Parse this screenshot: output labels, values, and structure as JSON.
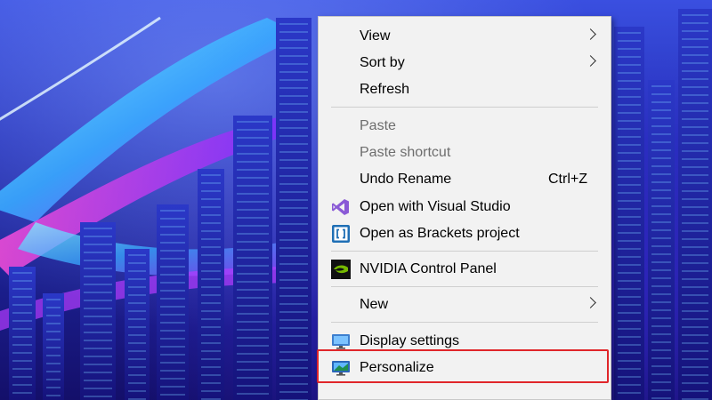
{
  "desktop": {
    "wallpaper": "neon city skyline with glowing curved light streaks"
  },
  "context_menu": {
    "items": [
      {
        "label": "View",
        "has_submenu": true
      },
      {
        "label": "Sort by",
        "has_submenu": true
      },
      {
        "label": "Refresh"
      },
      {
        "label": "Paste",
        "disabled": true
      },
      {
        "label": "Paste shortcut",
        "disabled": true
      },
      {
        "label": "Undo Rename",
        "shortcut": "Ctrl+Z"
      },
      {
        "label": "Open with Visual Studio",
        "icon": "visual-studio-icon"
      },
      {
        "label": "Open as Brackets project",
        "icon": "brackets-icon"
      },
      {
        "label": "NVIDIA Control Panel",
        "icon": "nvidia-icon"
      },
      {
        "label": "New",
        "has_submenu": true
      },
      {
        "label": "Display settings",
        "icon": "display-settings-icon"
      },
      {
        "label": "Personalize",
        "icon": "personalize-icon",
        "highlighted": true
      }
    ]
  },
  "colors": {
    "menu_background": "#f2f2f2",
    "disabled_text": "#6d6d6d",
    "highlight_border": "#e0262a"
  }
}
